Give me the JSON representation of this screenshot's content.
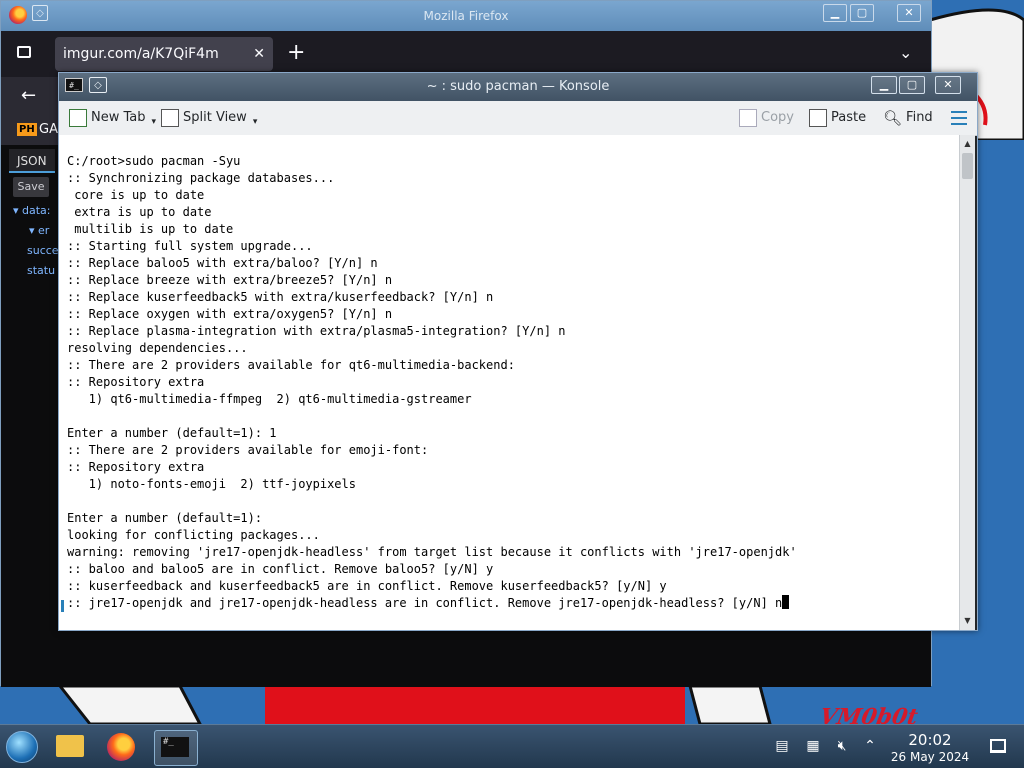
{
  "firefox": {
    "window_title": "Mozilla Firefox",
    "tab_title": "imgur.com/a/K7QiF4m",
    "tab_close": "✕",
    "new_tab": "+",
    "tab_list": "⌄",
    "back": "←",
    "bookmark_badge": "PH",
    "bookmark_label": "GAM",
    "json_tab": "JSON",
    "save_button": "Save",
    "tree": [
      "▾ data:",
      "▾ er",
      "succe",
      "statu"
    ]
  },
  "konsole": {
    "window_title": "~ : sudo pacman — Konsole",
    "toolbar": {
      "new_tab": "New Tab",
      "split_view": "Split View",
      "copy": "Copy",
      "paste": "Paste",
      "find": "Find"
    },
    "terminal_lines": [
      "C:/root>sudo pacman -Syu",
      ":: Synchronizing package databases...",
      " core is up to date",
      " extra is up to date",
      " multilib is up to date",
      ":: Starting full system upgrade...",
      ":: Replace baloo5 with extra/baloo? [Y/n] n",
      ":: Replace breeze with extra/breeze5? [Y/n] n",
      ":: Replace kuserfeedback5 with extra/kuserfeedback? [Y/n] n",
      ":: Replace oxygen with extra/oxygen5? [Y/n] n",
      ":: Replace plasma-integration with extra/plasma5-integration? [Y/n] n",
      "resolving dependencies...",
      ":: There are 2 providers available for qt6-multimedia-backend:",
      ":: Repository extra",
      "   1) qt6-multimedia-ffmpeg  2) qt6-multimedia-gstreamer",
      "",
      "Enter a number (default=1): 1",
      ":: There are 2 providers available for emoji-font:",
      ":: Repository extra",
      "   1) noto-fonts-emoji  2) ttf-joypixels",
      "",
      "Enter a number (default=1):",
      "looking for conflicting packages...",
      "warning: removing 'jre17-openjdk-headless' from target list because it conflicts with 'jre17-openjdk'",
      ":: baloo and baloo5 are in conflict. Remove baloo5? [y/N] y",
      ":: kuserfeedback and kuserfeedback5 are in conflict. Remove kuserfeedback5? [y/N] y",
      ":: jre17-openjdk and jre17-openjdk-headless are in conflict. Remove jre17-openjdk-headless? [y/N] n"
    ]
  },
  "taskbar": {
    "time": "20:02",
    "date": "26 May 2024",
    "konsole_icon_text": "#_"
  },
  "wallpaper": {
    "signature": "VM0b0t"
  }
}
